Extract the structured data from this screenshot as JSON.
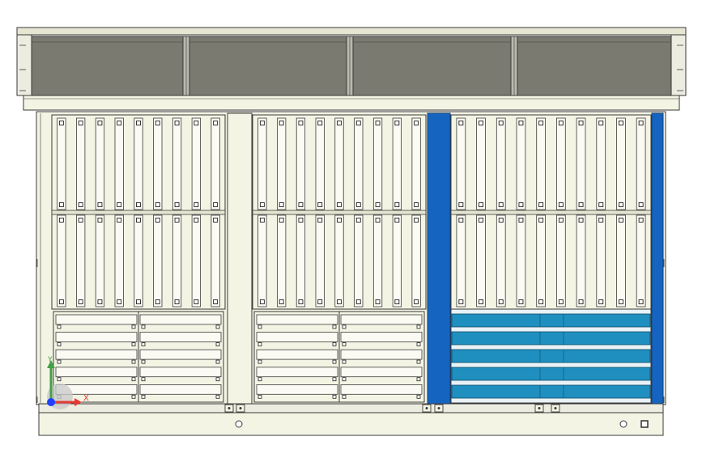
{
  "viewport": {
    "axis_labels": {
      "x": "X",
      "y": "Y"
    }
  },
  "colors": {
    "background": "#ffffff",
    "cream": "#f4f4e4",
    "cream_dark": "#e6e6d2",
    "outline": "#3a3a3a",
    "roof_gray": "#7a7a70",
    "roof_dark": "#5c5c55",
    "blue_post": "#1565c0",
    "teal_drawer": "#1f8fbf",
    "axis_x": "#e53935",
    "axis_y": "#43a047",
    "axis_z": "#1e40ff"
  },
  "model": {
    "roof_bays": 4,
    "frame_bays": 3,
    "rack_columns_per_bay": 9,
    "rack_rows": 2,
    "drawer_rows": 5,
    "highlighted_bay": 3
  }
}
